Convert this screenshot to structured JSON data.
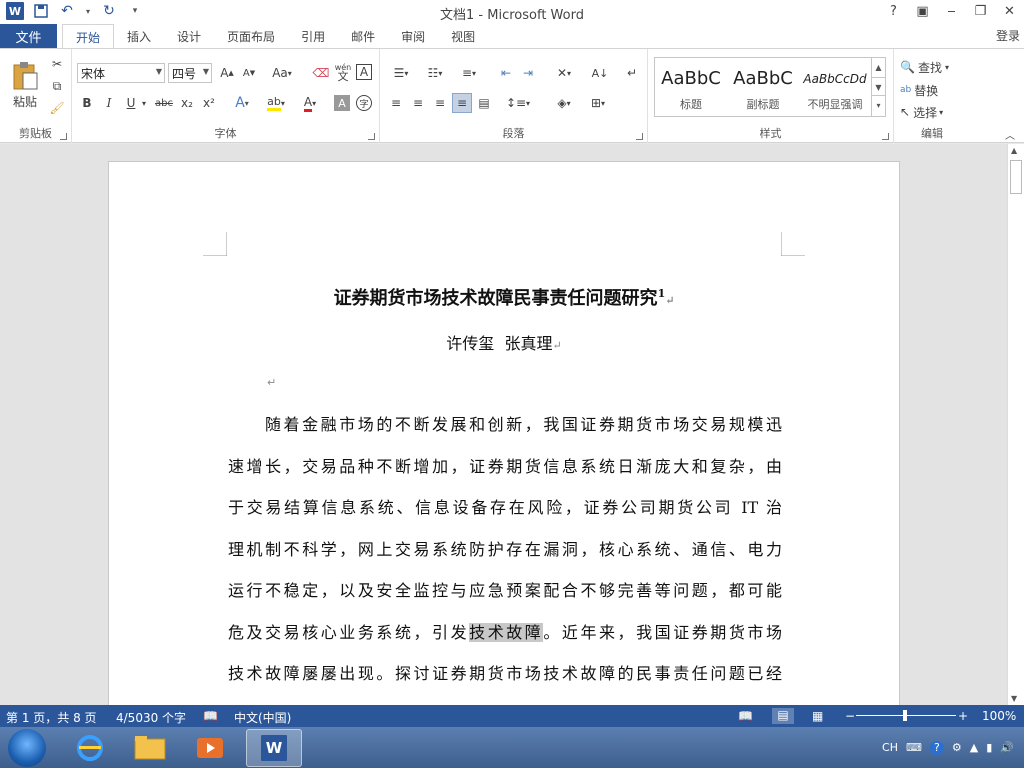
{
  "window": {
    "title": "文档1 - Microsoft Word",
    "help": "?",
    "signin": "登录"
  },
  "tabs": {
    "file": "文件",
    "items": [
      "开始",
      "插入",
      "设计",
      "页面布局",
      "引用",
      "邮件",
      "审阅",
      "视图"
    ],
    "active": "开始"
  },
  "ribbon": {
    "clipboard": {
      "label": "剪贴板",
      "paste": "粘贴"
    },
    "font": {
      "label": "字体",
      "name": "宋体",
      "size": "四号",
      "case": "Aa",
      "bold": "B",
      "italic": "I",
      "underline": "U",
      "strike": "abc",
      "sub": "x₂",
      "sup": "x²",
      "wen": "wén",
      "border_a": "A",
      "char_a": "字"
    },
    "paragraph": {
      "label": "段落"
    },
    "styles": {
      "label": "样式",
      "items": [
        {
          "sample": "AaBbC",
          "name": "标题"
        },
        {
          "sample": "AaBbC",
          "name": "副标题"
        },
        {
          "sample": "AaBbCcDd",
          "name": "不明显强调"
        }
      ]
    },
    "editing": {
      "label": "编辑",
      "find": "查找",
      "replace": "替换",
      "select": "选择"
    }
  },
  "document": {
    "title": "证券期货市场技术故障民事责任问题研究",
    "footnote_ref": "1",
    "authors": "许传玺  张真理",
    "para_lines": [
      "随着金融市场的不断发展和创新，我国证券期货市场交易规模迅",
      "速增长，交易品种不断增加，证券期货信息系统日渐庞大和复杂，由",
      "于交易结算信息系统、信息设备存在风险，证券公司期货公司 IT 治",
      "理机制不科学，网上交易系统防护存在漏洞，核心系统、通信、电力",
      "运行不稳定，以及安全监控与应急预案配合不够完善等问题，都可能"
    ],
    "line6_before": "危及交易核心业务系统，引发",
    "line6_highlight": "技术故障",
    "line6_after": "。近年来，我国证券期货市场",
    "line7": "技术故障屡屡出现。探讨证券期货市场技术故障的民事责任问题已经"
  },
  "status": {
    "page": "第 1 页，共 8 页",
    "words": "4/5030 个字",
    "language": "中文(中国)",
    "zoom": "100%"
  },
  "tray": {
    "ime": "CH"
  },
  "colors": {
    "accent": "#2b579a",
    "highlight": "#c8c8c8"
  }
}
